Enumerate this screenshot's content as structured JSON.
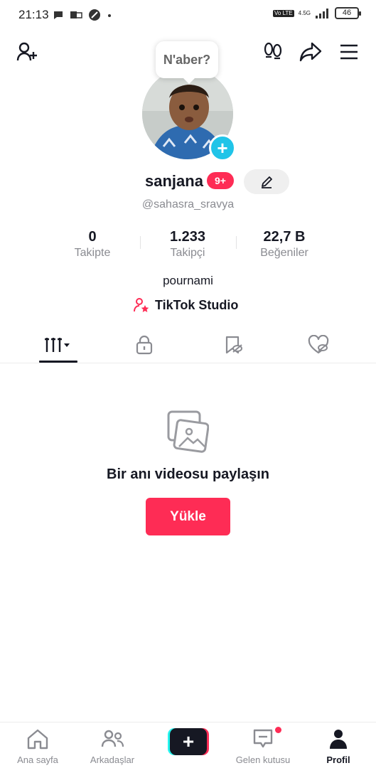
{
  "status_bar": {
    "time": "21:13",
    "network": "4.5G",
    "volte": "Vo LTE",
    "battery": "46"
  },
  "bubble": {
    "text": "N'aber?"
  },
  "profile": {
    "username": "sanjana",
    "notification_badge": "9+",
    "handle": "@sahasra_sravya",
    "bio": "pournami",
    "studio_link": "TikTok Studio"
  },
  "stats": [
    {
      "value": "0",
      "label": "Takipte"
    },
    {
      "value": "1.233",
      "label": "Takipçi"
    },
    {
      "value": "22,7 B",
      "label": "Beğeniler"
    }
  ],
  "empty_state": {
    "title": "Bir anı videosu paylaşın",
    "button_label": "Yükle"
  },
  "bottom_nav": [
    {
      "label": "Ana sayfa",
      "icon": "home-icon"
    },
    {
      "label": "Arkadaşlar",
      "icon": "friends-icon"
    },
    {
      "label": "",
      "icon": "create-plus-icon"
    },
    {
      "label": "Gelen kutusu",
      "icon": "inbox-icon"
    },
    {
      "label": "Profil",
      "icon": "profile-icon"
    }
  ],
  "colors": {
    "accent": "#fe2c55",
    "cyan": "#25f4ee",
    "avatar_add": "#20c4e8",
    "text": "#161823",
    "muted": "#8a8b91"
  }
}
